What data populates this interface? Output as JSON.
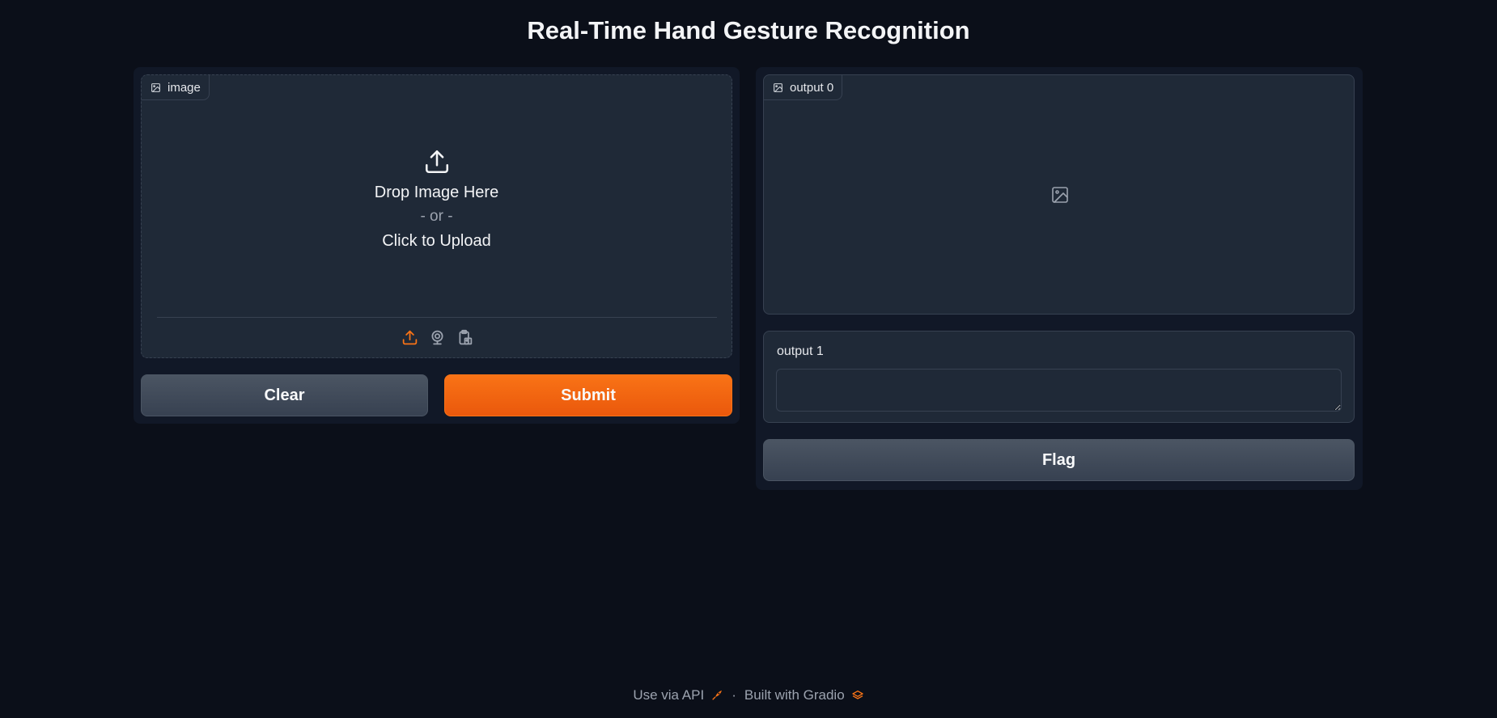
{
  "page": {
    "title": "Real-Time Hand Gesture Recognition"
  },
  "input": {
    "label": "image",
    "drop_text": "Drop Image Here",
    "or_text": "- or -",
    "click_text": "Click to Upload",
    "sources": [
      "upload-icon",
      "webcam-icon",
      "clipboard-icon"
    ],
    "active_source_color": "#f97316"
  },
  "buttons": {
    "clear_label": "Clear",
    "submit_label": "Submit",
    "flag_label": "Flag"
  },
  "output": {
    "image_label": "output 0",
    "text_label": "output 1",
    "text_value": ""
  },
  "footer": {
    "api_label": "Use via API",
    "separator": "·",
    "built_label": "Built with Gradio"
  },
  "colors": {
    "background": "#0b0f19",
    "panel": "#111827",
    "block": "#1f2937",
    "accent": "#f97316"
  }
}
